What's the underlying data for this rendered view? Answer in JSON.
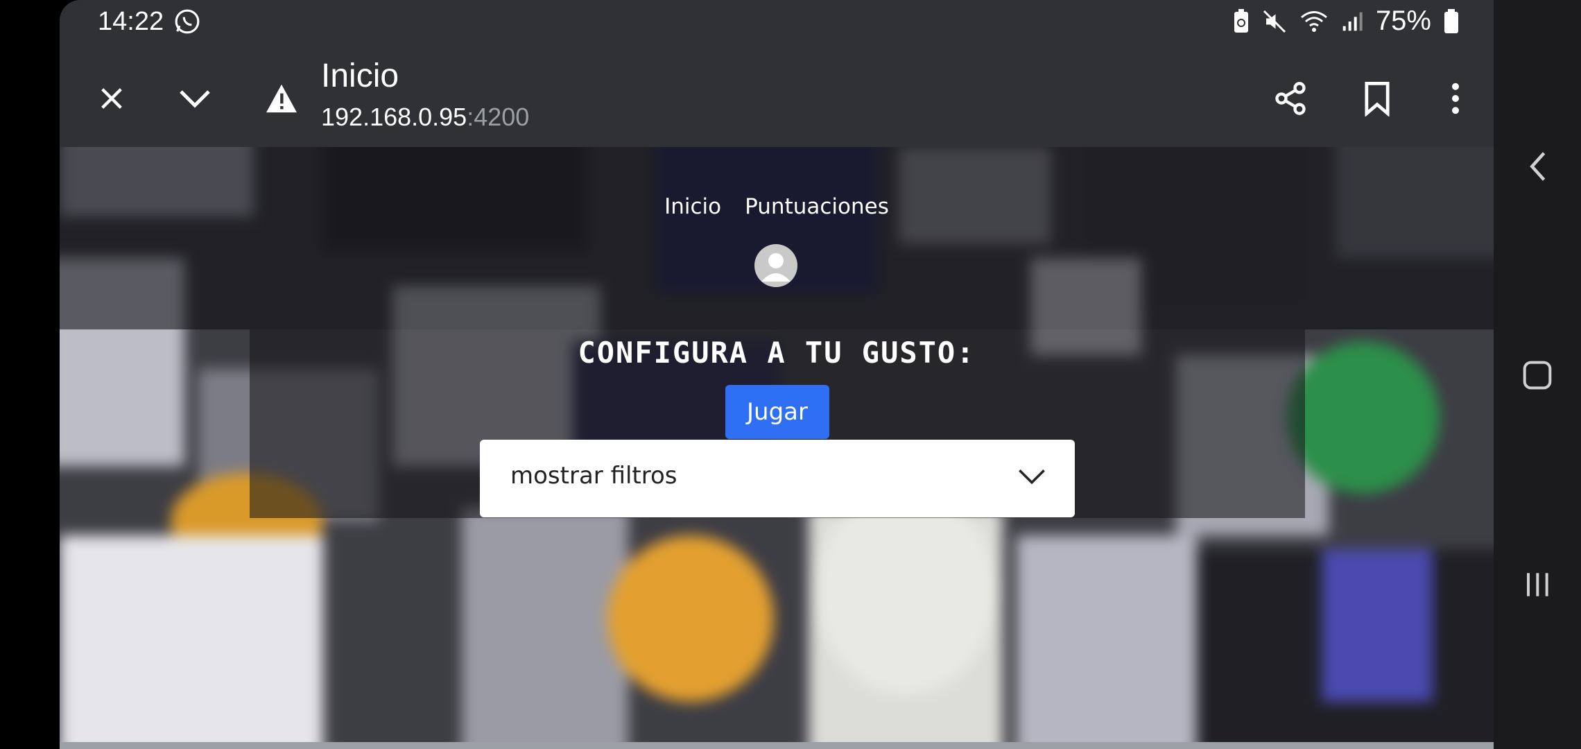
{
  "status_bar": {
    "time": "14:22",
    "battery": "75%",
    "icons": [
      "whatsapp-icon",
      "battery-saver-icon",
      "mute-icon",
      "wifi-icon",
      "signal-icon",
      "battery-icon"
    ]
  },
  "browser": {
    "title": "Inicio",
    "url_host": "192.168.0.95",
    "url_port": ":4200",
    "icons": [
      "close-icon",
      "chevron-down-icon",
      "warning-icon",
      "share-icon",
      "bookmark-icon",
      "more-vert-icon"
    ]
  },
  "page": {
    "nav": {
      "home": "Inicio",
      "scores": "Puntuaciones"
    },
    "config_title": "CONFIGURA A TU GUSTO:",
    "play_button": "Jugar",
    "filters_select": "mostrar filtros"
  },
  "colors": {
    "toolbar_bg": "#303134",
    "accent_button": "#2e6ff3",
    "port_gray": "#9aa0a6"
  }
}
